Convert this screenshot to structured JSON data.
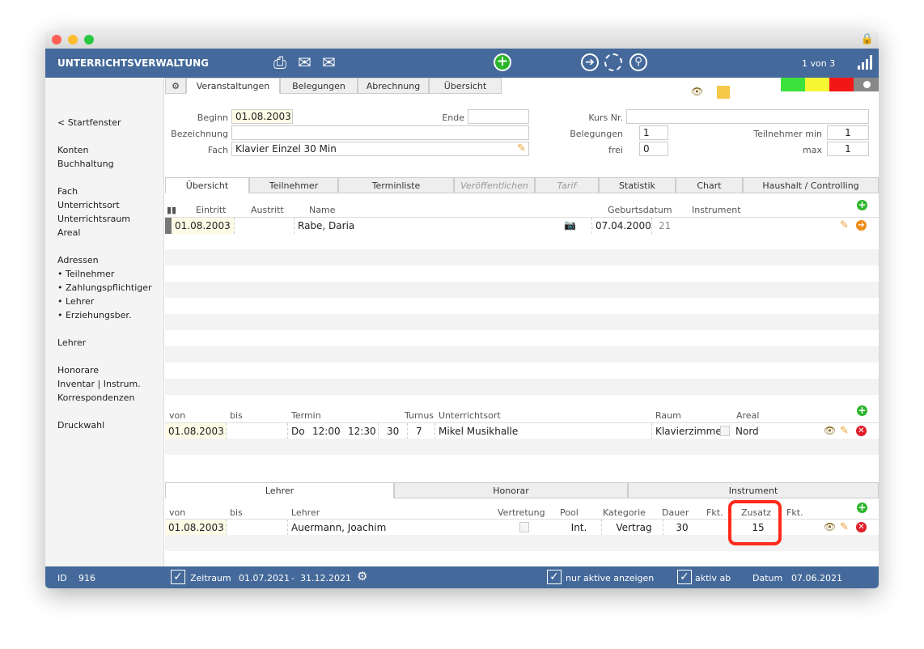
{
  "header": {
    "title": "UNTERRICHTSVERWALTUNG",
    "record": "1 von 3"
  },
  "top_tabs": [
    "Veranstaltungen",
    "Belegungen",
    "Abrechnung",
    "Übersicht"
  ],
  "status_colors": [
    "#3de33d",
    "#f6f634",
    "#f21616",
    "#888888"
  ],
  "sidebar": {
    "back": "< Startfenster",
    "groups": [
      [
        "Konten",
        "Buchhaltung"
      ],
      [
        "Fach",
        "Unterrichtsort",
        "Unterrichtsraum",
        "Areal"
      ],
      [
        "Adressen",
        "• Teilnehmer",
        "• Zahlungspflichtiger",
        "• Lehrer",
        "• Erziehungsber."
      ],
      [
        "Lehrer"
      ],
      [
        "Honorare",
        "Inventar | Instrum.",
        "Korrespondenzen"
      ],
      [
        "Druckwahl"
      ]
    ]
  },
  "form": {
    "beginn_label": "Beginn",
    "beginn": "01.08.2003",
    "ende_label": "Ende",
    "ende": "",
    "bezeichnung_label": "Bezeichnung",
    "bezeichnung": "",
    "fach_label": "Fach",
    "fach": "Klavier Einzel 30 Min",
    "kursnr_label": "Kurs Nr.",
    "kursnr": "",
    "belegungen_label": "Belegungen",
    "belegungen": "1",
    "frei_label": "frei",
    "frei": "0",
    "tmin_label": "Teilnehmer min",
    "tmin": "1",
    "max_label": "max",
    "max": "1"
  },
  "sub_tabs": [
    {
      "label": "Übersicht"
    },
    {
      "label": "Teilnehmer"
    },
    {
      "label": "Terminliste"
    },
    {
      "label": "Veröffentlichen"
    },
    {
      "label": "Tarif"
    },
    {
      "label": "Statistik"
    },
    {
      "label": "Chart"
    },
    {
      "label": "Haushalt / Controlling"
    }
  ],
  "participants": {
    "headers": [
      "Eintritt",
      "Austritt",
      "Name",
      "Geburtsdatum",
      "Instrument"
    ],
    "rows": [
      {
        "eintritt": "01.08.2003",
        "austritt": "",
        "name": "Rabe, Daria",
        "geburtsdatum": "07.04.2000",
        "alter": "21",
        "instrument": ""
      }
    ]
  },
  "schedule": {
    "headers": [
      "von",
      "bis",
      "Termin",
      "Turnus",
      "Unterrichtsort",
      "Raum",
      "Areal"
    ],
    "rows": [
      {
        "von": "01.08.2003",
        "bis": "",
        "tag": "Do",
        "start": "12:00",
        "end": "12:30",
        "dauer": "30",
        "turnus": "7",
        "ort": "Mikel Musikhalle",
        "raum": "Klavierzimmer",
        "areal": "Nord"
      }
    ]
  },
  "lower_tabs": [
    "Lehrer",
    "Honorar",
    "Instrument"
  ],
  "teachers": {
    "headers": [
      "von",
      "bis",
      "Lehrer",
      "Vertretung",
      "Pool",
      "Kategorie",
      "Dauer",
      "Fkt.",
      "Zusatz",
      "Fkt."
    ],
    "rows": [
      {
        "von": "01.08.2003",
        "bis": "",
        "lehrer": "Auermann, Joachim",
        "pool": "Int.",
        "kategorie": "Vertrag",
        "dauer": "30",
        "fkt": "",
        "zusatz": "15",
        "fkt2": ""
      }
    ]
  },
  "footer": {
    "id_label": "ID",
    "id": "916",
    "zeitraum_label": "Zeitraum",
    "zeitraum_from": "01.07.2021",
    "zeitraum_sep": "-",
    "zeitraum_to": "31.12.2021",
    "nur_aktive": "nur aktive anzeigen",
    "aktiv_ab": "aktiv ab",
    "datum_label": "Datum",
    "datum": "07.06.2021"
  },
  "highlight_color": "#ff2a1a"
}
